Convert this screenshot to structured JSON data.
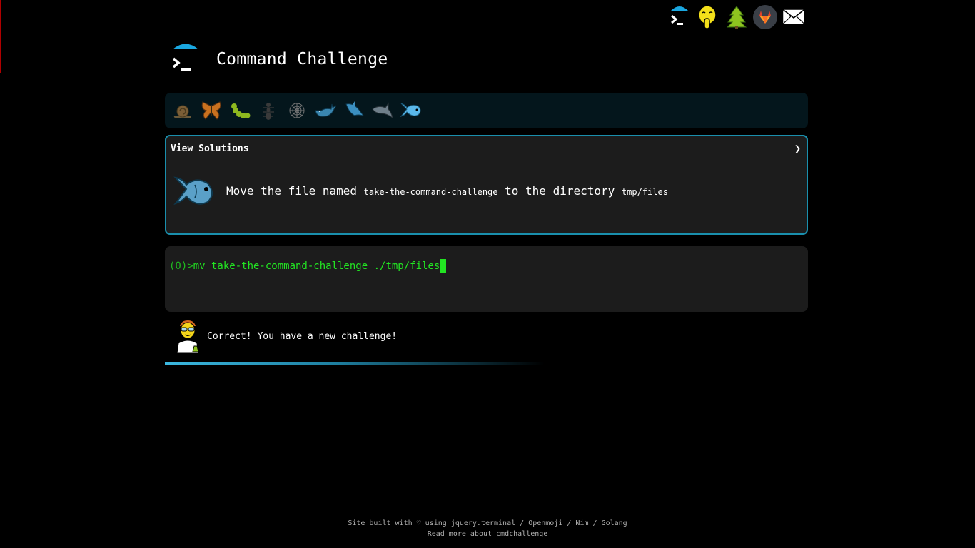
{
  "header": {
    "title": "Command Challenge"
  },
  "top_icons": [
    {
      "name": "terminal-logo-icon"
    },
    {
      "name": "shushing-face-icon"
    },
    {
      "name": "tree-icon"
    },
    {
      "name": "gitlab-icon"
    },
    {
      "name": "envelope-icon"
    }
  ],
  "levels": [
    {
      "name": "snail-icon"
    },
    {
      "name": "butterfly-icon"
    },
    {
      "name": "caterpillar-icon"
    },
    {
      "name": "ant-icon"
    },
    {
      "name": "spider-web-icon"
    },
    {
      "name": "whale-icon"
    },
    {
      "name": "shark-icon"
    },
    {
      "name": "dolphin-icon"
    },
    {
      "name": "fish-icon"
    }
  ],
  "challenge": {
    "header_label": "View Solutions",
    "chevron": "❯",
    "text_1": "Move the file named ",
    "file": "take-the-command-challenge",
    "text_2": " to the directory ",
    "dir": "tmp/files"
  },
  "terminal": {
    "prompt": "(0)> ",
    "command": "mv take-the-command-challenge ./tmp/files"
  },
  "feedback": {
    "message": "Correct! You have a new challenge!"
  },
  "progress": {
    "fraction": 0.59
  },
  "footer": {
    "line1_prefix": "Site built with ♡ using ",
    "link_jquery": "jquery.terminal",
    "sep1": " / ",
    "link_openmoji": "Openmoji",
    "sep2": " / ",
    "link_nim": "Nim",
    "sep3": " / ",
    "link_golang": "Golang",
    "line2": "Read more about cmdchallenge"
  },
  "colors": {
    "accent": "#1a8fad",
    "terminal_green": "#22e422",
    "background": "#000000"
  }
}
